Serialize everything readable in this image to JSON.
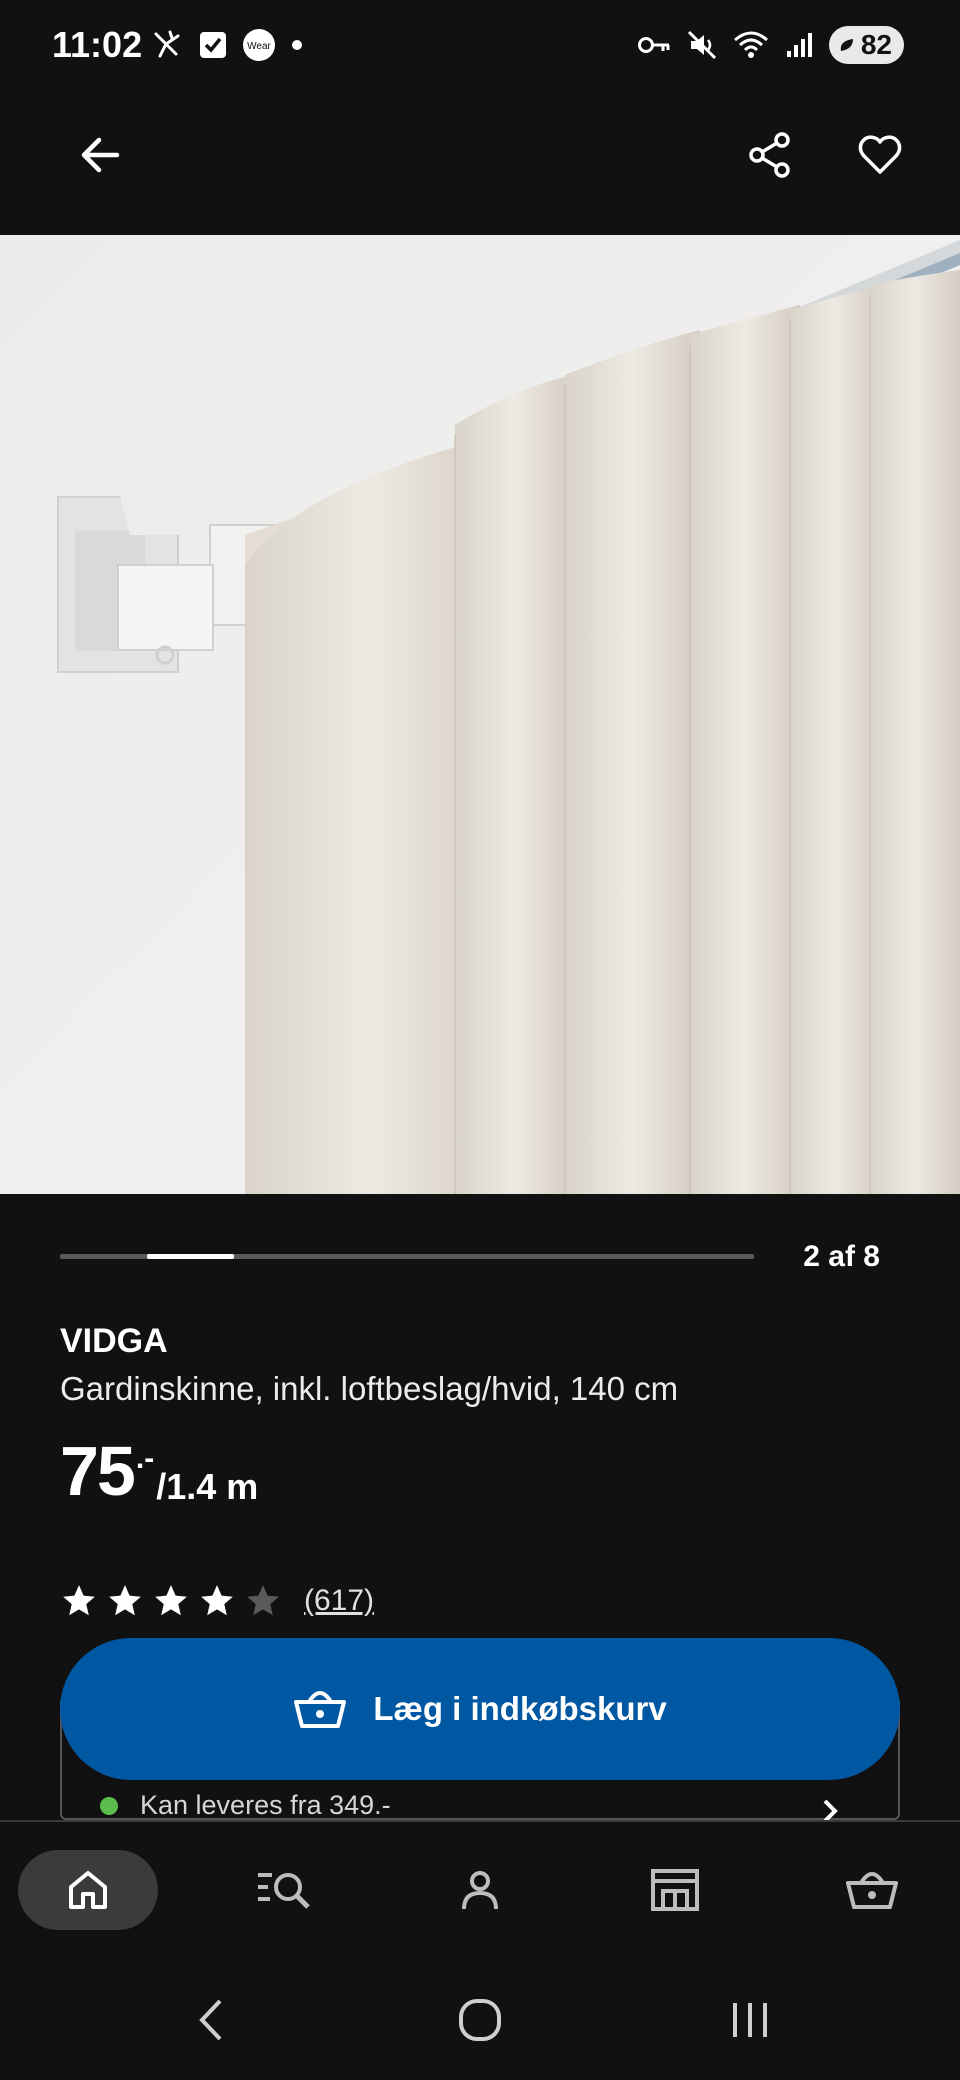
{
  "status_bar": {
    "time": "11:02",
    "left_icons": [
      "fitness-icon",
      "task-check-icon",
      "wear-icon",
      "dot-icon"
    ],
    "wear_label": "Wear",
    "right_icons": [
      "key-icon",
      "mute-icon",
      "wifi-icon",
      "signal-icon"
    ],
    "battery": "82"
  },
  "top_bar": {
    "back_icon": "arrow-left-icon",
    "share_icon": "share-icon",
    "favorite_icon": "heart-icon"
  },
  "carousel": {
    "page_label": "2 af 8",
    "current": 2,
    "total": 8
  },
  "product": {
    "name": "VIDGA",
    "description": "Gardinskinne, inkl. loftbeslag/hvid, 140 cm",
    "price_integer": "75",
    "price_decimal": ".-",
    "price_unit": "/1.4 m",
    "rating": 4,
    "rating_max": 5,
    "reviews": "(617)"
  },
  "cta": {
    "label": "Læg i indkøbskurv",
    "icon": "basket-icon",
    "color": "#0058a3"
  },
  "delivery": {
    "text": "Kan leveres fra 349.-",
    "status_color": "#5bbd4b"
  },
  "bottom_nav": {
    "items": [
      {
        "icon": "home-icon",
        "active": true
      },
      {
        "icon": "search-list-icon",
        "active": false
      },
      {
        "icon": "profile-icon",
        "active": false
      },
      {
        "icon": "store-icon",
        "active": false
      },
      {
        "icon": "basket-icon",
        "active": false
      }
    ]
  },
  "system_nav": {
    "items": [
      "back-icon",
      "home-circle-icon",
      "recents-icon"
    ]
  }
}
